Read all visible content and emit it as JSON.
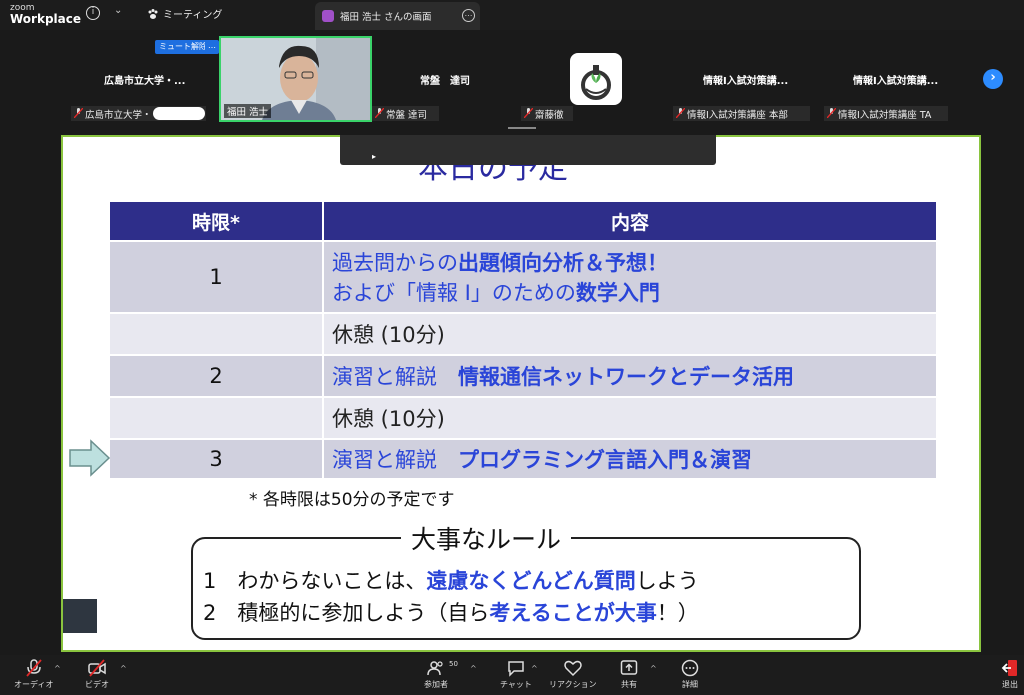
{
  "titlebar": {
    "brand_line1": "zoom",
    "brand_line2": "Workplace",
    "meeting_label": "ミーティング",
    "share_tab_label": "福田 浩士 さんの画面"
  },
  "participants": {
    "mute_button": "ミュート解除",
    "more_button": "…",
    "tile_names": [
      "広島市立大学・...",
      "常盤　達司",
      "情報Ⅰ入試対策講...",
      "情報Ⅰ入試対策講..."
    ],
    "tags": [
      "広島市立大学・",
      "福田 浩士",
      "常盤 達司",
      "齋藤徹",
      "情報Ⅰ入試対策講座 本部",
      "情報Ⅰ入試対策講座 TA"
    ],
    "next_arrow": "›"
  },
  "slide": {
    "title": "本日の予定",
    "table": {
      "headers": [
        "時限*",
        "内容"
      ],
      "rows": [
        {
          "period": "1",
          "line1_plain": "過去問からの",
          "line1_bold": "出題傾向分析＆予想！",
          "line2_plain": "および「情報 I」のための",
          "line2_bold": "数学入門"
        },
        {
          "period": "",
          "text": "休憩 (10分)"
        },
        {
          "period": "2",
          "plain": "演習と解説　",
          "bold": "情報通信ネットワークとデータ活用"
        },
        {
          "period": "",
          "text": "休憩 (10分)"
        },
        {
          "period": "3",
          "plain": "演習と解説　",
          "bold": "プログラミング言語入門＆演習"
        }
      ]
    },
    "note": "* 各時限は50分の予定です",
    "rules_title": "大事なルール",
    "rules": [
      {
        "num": "1",
        "pre": "わからないことは、",
        "bold": "遠慮なくどんどん質問",
        "post": "しよう"
      },
      {
        "num": "2",
        "pre": "積極的に参加しよう（自ら",
        "bold": "考えることが大事",
        "post": "！）"
      }
    ]
  },
  "toolbar": {
    "audio": "オーディオ",
    "video": "ビデオ",
    "participants": "参加者",
    "participant_count": "50",
    "chat": "チャット",
    "reaction": "リアクション",
    "share": "共有",
    "details": "詳細",
    "leave": "退出"
  },
  "colors": {
    "header_blue": "#2e2e8a",
    "text_blue": "#2a45d8",
    "active_speaker": "#3ad36a",
    "zoom_blue": "#2d8cff",
    "leave_red": "#e02828"
  }
}
